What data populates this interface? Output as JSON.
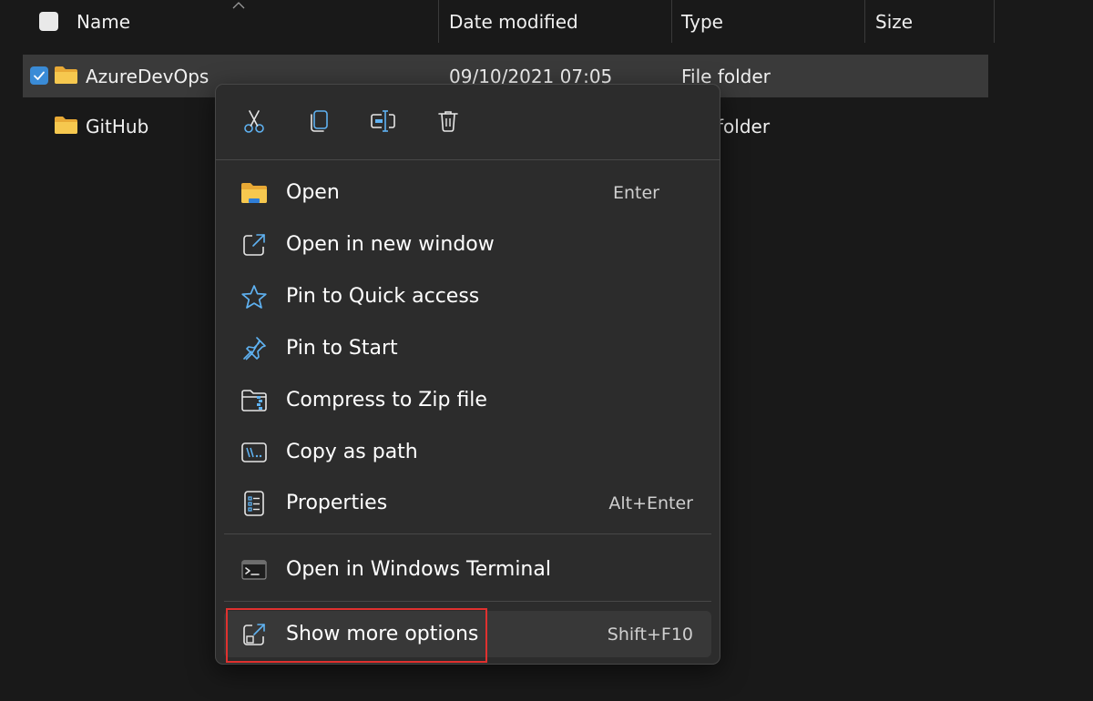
{
  "columns": {
    "name": "Name",
    "date_modified": "Date modified",
    "type": "Type",
    "size": "Size"
  },
  "files": [
    {
      "name": "AzureDevOps",
      "date_modified": "09/10/2021 07:05",
      "type": "File folder",
      "selected": true
    },
    {
      "name": "GitHub",
      "date_modified": "",
      "type": "folder",
      "selected": false
    }
  ],
  "context_menu": {
    "toolbar": [
      {
        "icon": "cut-icon",
        "label": "Cut"
      },
      {
        "icon": "copy-icon",
        "label": "Copy"
      },
      {
        "icon": "rename-icon",
        "label": "Rename"
      },
      {
        "icon": "delete-icon",
        "label": "Delete"
      }
    ],
    "items": [
      {
        "icon": "folder-open-icon",
        "label": "Open",
        "shortcut": "Enter"
      },
      {
        "icon": "open-new-window-icon",
        "label": "Open in new window",
        "shortcut": ""
      },
      {
        "icon": "star-icon",
        "label": "Pin to Quick access",
        "shortcut": ""
      },
      {
        "icon": "pin-icon",
        "label": "Pin to Start",
        "shortcut": ""
      },
      {
        "icon": "zip-folder-icon",
        "label": "Compress to Zip file",
        "shortcut": ""
      },
      {
        "icon": "copy-path-icon",
        "label": "Copy as path",
        "shortcut": ""
      },
      {
        "icon": "properties-icon",
        "label": "Properties",
        "shortcut": "Alt+Enter"
      },
      {
        "icon": "terminal-icon",
        "label": "Open in Windows Terminal",
        "shortcut": ""
      },
      {
        "icon": "show-more-icon",
        "label": "Show more options",
        "shortcut": "Shift+F10"
      }
    ]
  },
  "colors": {
    "background": "#191919",
    "menu_background": "#2c2c2c",
    "selected_row": "#3a3a3a",
    "accent": "#3a8bd6",
    "icon_blue": "#5fb2f2",
    "folder_yellow": "#f4c24d",
    "highlight_red": "#e0312f"
  }
}
